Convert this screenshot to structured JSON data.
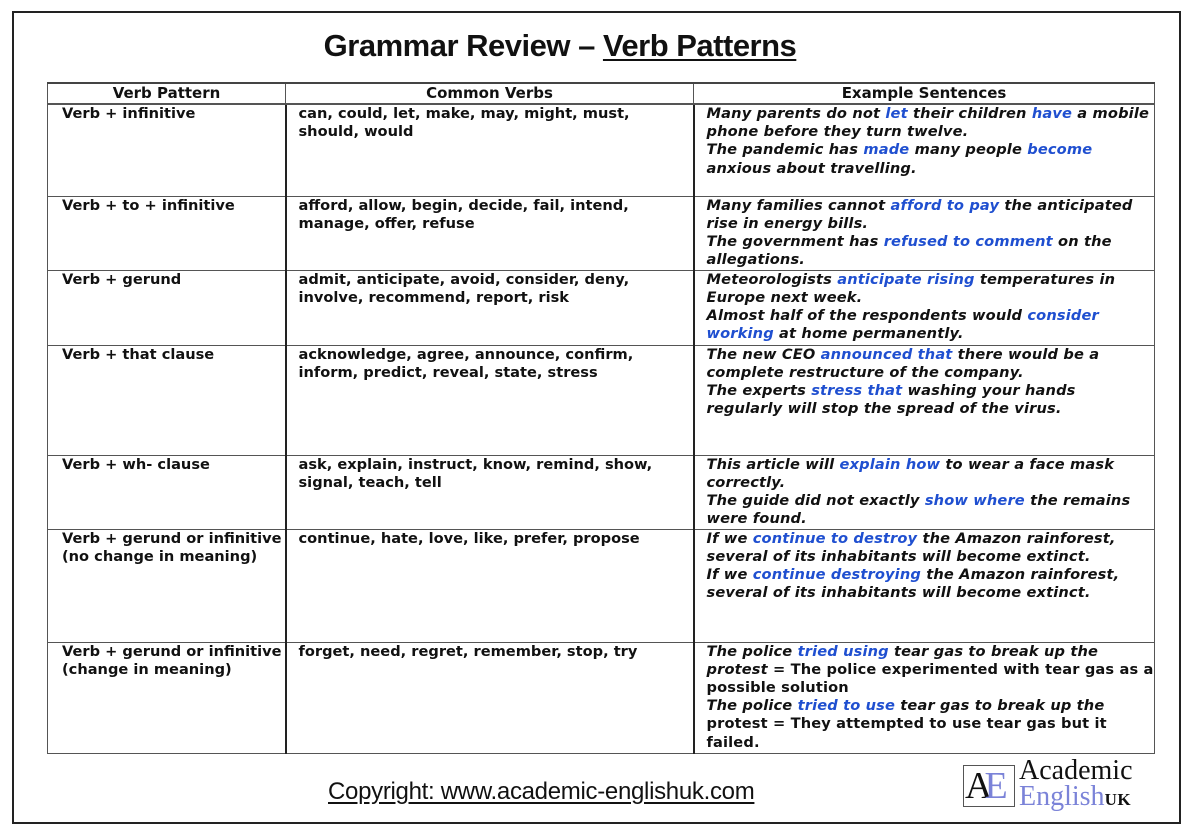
{
  "document": {
    "title_prefix": "Grammar Review – ",
    "title_underlined": "Verb Patterns",
    "footer_copyright": "Copyright: www.academic-englishuk.com",
    "logo": {
      "mark_a": "A",
      "mark_e": "E",
      "line1": "Academic",
      "line2": "English",
      "suffix": "UK"
    },
    "highlight_color": "#1f4fd0"
  },
  "table": {
    "headers": [
      "Verb Pattern",
      "Common Verbs",
      "Example Sentences"
    ],
    "rows": [
      {
        "pattern": "Verb + infinitive",
        "verbs": "can, could, let, make, may, might, must, should, would",
        "examples": [
          {
            "parts": [
              {
                "t": "Many parents do not "
              },
              {
                "t": "let",
                "hl": true
              },
              {
                "t": " their children "
              },
              {
                "t": "have",
                "hl": true
              },
              {
                "t": " a mobile phone before they turn twelve."
              }
            ]
          },
          {
            "parts": [
              {
                "t": "The pandemic has "
              },
              {
                "t": "made",
                "hl": true
              },
              {
                "t": " many people "
              },
              {
                "t": "become",
                "hl": true
              },
              {
                "t": " anxious about travelling."
              }
            ]
          }
        ]
      },
      {
        "pattern": "Verb + to + infinitive",
        "verbs": "afford, allow, begin, decide, fail, intend, manage, offer, refuse",
        "examples": [
          {
            "parts": [
              {
                "t": "Many families cannot "
              },
              {
                "t": "afford to pay",
                "hl": true
              },
              {
                "t": " the anticipated rise in energy bills."
              }
            ]
          },
          {
            "parts": [
              {
                "t": "The government has "
              },
              {
                "t": "refused to comment",
                "hl": true
              },
              {
                "t": " on the allegations."
              }
            ]
          }
        ]
      },
      {
        "pattern": "Verb + gerund",
        "verbs": "admit, anticipate, avoid, consider, deny, involve, recommend, report, risk",
        "examples": [
          {
            "parts": [
              {
                "t": "Meteorologists "
              },
              {
                "t": "anticipate rising",
                "hl": true
              },
              {
                "t": " temperatures in Europe next week."
              }
            ]
          },
          {
            "parts": [
              {
                "t": "Almost half of the respondents would "
              },
              {
                "t": "consider working",
                "hl": true
              },
              {
                "t": " at home permanently."
              }
            ]
          }
        ]
      },
      {
        "pattern": "Verb + that clause",
        "verbs": "acknowledge, agree, announce, confirm, inform, predict, reveal, state, stress",
        "examples": [
          {
            "parts": [
              {
                "t": "The new CEO "
              },
              {
                "t": "announced that",
                "hl": true
              },
              {
                "t": " there would be a complete restructure of the company."
              }
            ]
          },
          {
            "parts": [
              {
                "t": "The experts "
              },
              {
                "t": "stress that",
                "hl": true
              },
              {
                "t": " washing your hands regularly will stop the spread of the virus."
              }
            ]
          }
        ]
      },
      {
        "pattern": "Verb + wh- clause",
        "verbs": "ask, explain, instruct, know, remind, show, signal, teach, tell",
        "examples": [
          {
            "parts": [
              {
                "t": "This article will "
              },
              {
                "t": "explain how",
                "hl": true
              },
              {
                "t": " to wear a face mask correctly."
              }
            ]
          },
          {
            "parts": [
              {
                "t": "The guide did not exactly "
              },
              {
                "t": "show where",
                "hl": true
              },
              {
                "t": " the remains were found."
              }
            ]
          }
        ]
      },
      {
        "pattern": "Verb + gerund or infinitive (no change in meaning)",
        "verbs": "continue, hate, love, like, prefer, propose",
        "examples": [
          {
            "parts": [
              {
                "t": "If we "
              },
              {
                "t": "continue to destroy",
                "hl": true
              },
              {
                "t": " the Amazon rainforest, several of its inhabitants will become extinct."
              }
            ]
          },
          {
            "parts": [
              {
                "t": "If we "
              },
              {
                "t": "continue destroying",
                "hl": true
              },
              {
                "t": " the Amazon rainforest, several of its inhabitants will become extinct."
              }
            ]
          }
        ]
      },
      {
        "pattern": "Verb + gerund or infinitive (change in meaning)",
        "verbs": "forget, need, regret, remember, stop, try",
        "examples": [
          {
            "parts": [
              {
                "t": "The police "
              },
              {
                "t": "tried using",
                "hl": true
              },
              {
                "t": " tear gas to break up the protest"
              },
              {
                "t": " = The police experimented with tear gas as a possible solution",
                "up": true
              }
            ]
          },
          {
            "parts": [
              {
                "t": "The police "
              },
              {
                "t": "tried to use",
                "hl": true
              },
              {
                "t": " tear gas to break up the"
              },
              {
                "t": " protest = They attempted to use tear gas but it failed.",
                "up": true
              }
            ]
          }
        ]
      }
    ]
  }
}
